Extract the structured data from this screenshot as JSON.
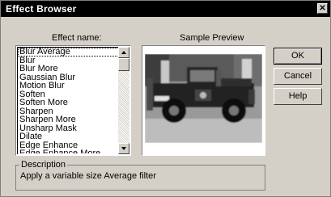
{
  "window": {
    "title": "Effect Browser",
    "close_glyph": "✕"
  },
  "labels": {
    "effect_name": "Effect name:",
    "sample_preview": "Sample Preview"
  },
  "effects_list": {
    "items": [
      {
        "label": "Blur Average",
        "selected": true
      },
      {
        "label": "Blur"
      },
      {
        "label": "Blur More"
      },
      {
        "label": "Gaussian Blur"
      },
      {
        "label": "Motion Blur"
      },
      {
        "label": "Soften"
      },
      {
        "label": "Soften More"
      },
      {
        "label": "Sharpen"
      },
      {
        "label": "Sharpen More"
      },
      {
        "label": "Unsharp Mask"
      },
      {
        "label": "Dilate"
      },
      {
        "label": "Edge Enhance"
      },
      {
        "label": "Edge Enhance More"
      }
    ]
  },
  "buttons": {
    "ok": "OK",
    "cancel": "Cancel",
    "help": "Help"
  },
  "description": {
    "label": "Description",
    "text": "Apply a variable size Average filter"
  },
  "icons": {
    "close": "close-icon",
    "scroll_up": "arrow-up-icon",
    "scroll_down": "arrow-down-icon"
  }
}
